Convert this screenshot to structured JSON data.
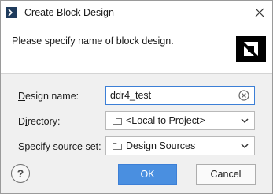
{
  "window": {
    "title": "Create Block Design",
    "close_icon": "close-icon"
  },
  "header": {
    "message": "Please specify name of block design.",
    "logo": "amd-logo"
  },
  "form": {
    "design_name": {
      "label_prefix": "",
      "label_mnemonic": "D",
      "label_rest": "esign name:",
      "value": "ddr4_test"
    },
    "directory": {
      "label_prefix": "D",
      "label_mnemonic": "i",
      "label_rest": "rectory:",
      "value": "<Local to Project>"
    },
    "source_set": {
      "label": "Specify source set:",
      "value": "Design Sources"
    }
  },
  "buttons": {
    "help": "?",
    "ok": "OK",
    "cancel": "Cancel"
  },
  "colors": {
    "accent": "#4a8fe0",
    "background": "#f0f0f0"
  }
}
